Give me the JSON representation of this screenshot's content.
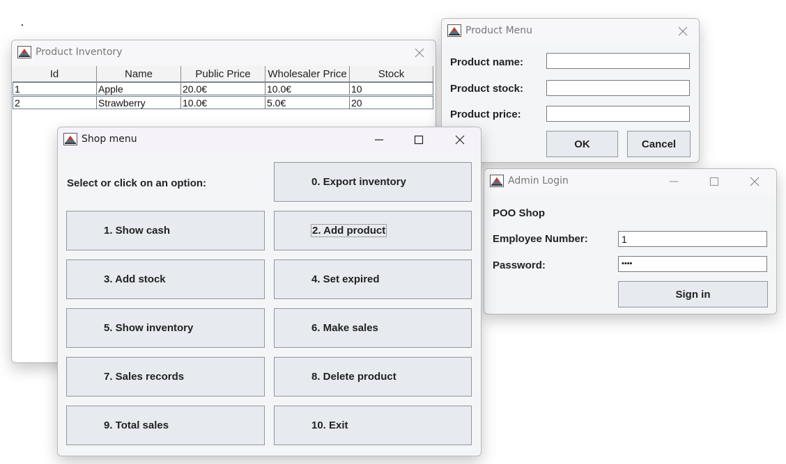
{
  "inventory": {
    "title": "Product Inventory",
    "columns": [
      "Id",
      "Name",
      "Public Price",
      "Wholesaler Price",
      "Stock"
    ],
    "rows": [
      [
        "1",
        "Apple",
        "20.0€",
        "10.0€",
        "10"
      ],
      [
        "2",
        "Strawberry",
        "10.0€",
        "5.0€",
        "20"
      ]
    ]
  },
  "product_menu": {
    "title": "Product Menu",
    "name_label": "Product name:",
    "stock_label": "Product stock:",
    "price_label": "Product price:",
    "name_value": "",
    "stock_value": "",
    "price_value": "",
    "ok_label": "OK",
    "cancel_label": "Cancel"
  },
  "admin_login": {
    "title": "Admin Login",
    "shop_name": "POO Shop",
    "employee_label": "Employee Number:",
    "employee_value": "1",
    "password_label": "Password:",
    "password_value": "••••",
    "signin_label": "Sign in"
  },
  "shop_menu": {
    "title": "Shop menu",
    "prompt": "Select or click on an option:",
    "options": [
      "0. Export inventory",
      "1. Show cash",
      "2. Add product",
      "3. Add stock",
      "4. Set expired",
      "5. Show inventory",
      "6. Make sales",
      "7. Sales records",
      "8. Delete product",
      "9. Total sales",
      "10. Exit"
    ]
  },
  "colors": {
    "button_bg": "#e7eaee",
    "button_border": "#8f97a0",
    "window_bg": "#f4f5f7",
    "active_titlebar": "#f5f2f9"
  }
}
